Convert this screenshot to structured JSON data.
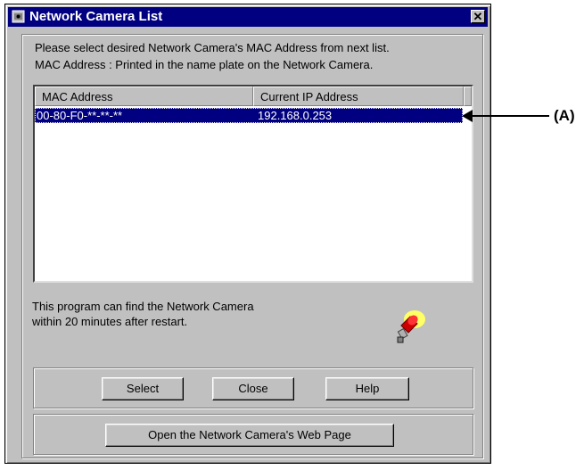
{
  "window": {
    "title": "Network Camera List",
    "close_glyph": "✕"
  },
  "instructions": {
    "line1": "Please select desired Network Camera's  MAC Address from next list.",
    "line2": "MAC Address : Printed in the name plate on the Network Camera."
  },
  "list": {
    "columns": [
      "MAC Address",
      "Current IP Address"
    ],
    "rows": [
      {
        "mac": "00-80-F0-**-**-**",
        "ip": "192.168.0.253",
        "selected": true
      }
    ]
  },
  "note": {
    "line1": "This program can find the Network Camera",
    "line2": "within 20 minutes after restart."
  },
  "buttons": {
    "select": "Select",
    "close": "Close",
    "help": "Help",
    "open_web": "Open the Network Camera's Web Page"
  },
  "callout": {
    "label": "(A)"
  },
  "colors": {
    "titlebar": "#000080",
    "selection": "#000080",
    "face": "#c0c0c0"
  },
  "icons": {
    "title": "app-window-icon",
    "camera": "network-camera-icon"
  }
}
